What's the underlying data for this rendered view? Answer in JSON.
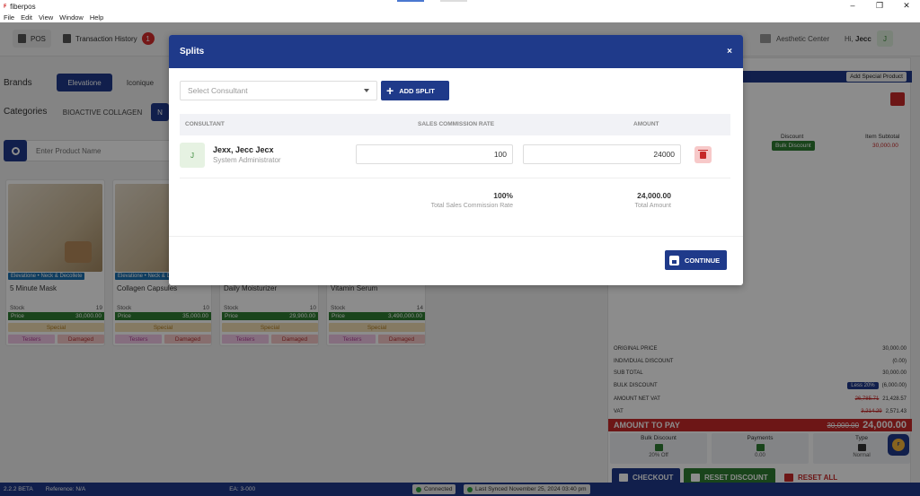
{
  "window": {
    "title": "fiberpos",
    "logo": "ꟳ",
    "controls": [
      "–",
      "❐",
      "✕"
    ]
  },
  "menu": [
    "File",
    "Edit",
    "View",
    "Window",
    "Help"
  ],
  "header": {
    "pos_label": "POS",
    "transactions_label": "Transaction History",
    "transactions_count": "1",
    "store_name": "Aesthetic Center",
    "greeting": "Hi,",
    "user_name": "Jecc",
    "user_initial": "J"
  },
  "left": {
    "brands_label": "Brands",
    "brands": [
      "Elevatione",
      "Iconique"
    ],
    "categories_label": "Categories",
    "categories": [
      "BIOACTIVE COLLAGEN",
      "N"
    ],
    "search_placeholder": "Enter Product Name",
    "stock_label": "Stock",
    "price_label": "Price",
    "special_label": "Special",
    "testers_label": "Testers",
    "damaged_label": "Damaged",
    "products": [
      {
        "tag": "Elevatione • Neck & Decollete",
        "name": "5 Minute Mask",
        "stock": "19",
        "price": "30,000.00"
      },
      {
        "tag": "Elevatione • Neck & D",
        "name": "Collagen Capsules",
        "stock": "10",
        "price": "35,000.00"
      },
      {
        "tag": "",
        "name": "Daily Moisturizer",
        "stock": "10",
        "price": "29,900.00"
      },
      {
        "tag": "",
        "name": "Vitamin Serum",
        "stock": "14",
        "price": "3,490,000.00"
      }
    ]
  },
  "cart": {
    "add_special": "Add Special Product",
    "discount_label": "Discount",
    "subtotal_label": "Item Subtotal",
    "bulk_discount_pill": "Bulk Discount",
    "subtotal_value": "30,000.00",
    "summary": [
      {
        "label": "ORIGINAL PRICE",
        "value": "30,000.00"
      },
      {
        "label": "INDIVIDUAL DISCOUNT",
        "value": "(0.00)"
      },
      {
        "label": "SUB TOTAL",
        "value": "30,000.00"
      }
    ],
    "bulk_discount_label": "BULK DISCOUNT",
    "bulk_less": "Less 20%",
    "bulk_value": "(6,000.00)",
    "net_vat_label": "AMOUNT NET VAT",
    "net_vat_old": "26,785.71",
    "net_vat_value": "21,428.57",
    "vat_label": "VAT",
    "vat_old": "3,214.29",
    "vat_value": "2,571.43",
    "amount_to_pay_label": "AMOUNT TO PAY",
    "amount_to_pay_old": "30,000.00",
    "amount_to_pay_value": "24,000.00",
    "info": [
      {
        "label": "Bulk Discount",
        "value": "20% Off"
      },
      {
        "label": "Payments",
        "value": "0.00"
      },
      {
        "label": "Type",
        "value": "Normal"
      }
    ],
    "checkout_label": "CHECKOUT",
    "reset_discount_label": "RESET DISCOUNT",
    "reset_all_label": "RESET ALL"
  },
  "footer": {
    "version": "2.2.2 BETA",
    "reference": "Reference: N/A",
    "ea": "EA: 3-000",
    "connected": "Connected",
    "last_synced": "Last Synced November 25, 2024 03:40 pm"
  },
  "modal": {
    "title": "Splits",
    "close": "×",
    "consultant_placeholder": "Select Consultant",
    "add_split_label": "ADD SPLIT",
    "col_consultant": "CONSULTANT",
    "col_rate": "SALES COMMISSION RATE",
    "col_amount": "AMOUNT",
    "row": {
      "initial": "J",
      "name": "Jexx, Jecc Jecx",
      "role": "System Administrator",
      "rate": "100",
      "amount": "24000"
    },
    "total_rate": "100%",
    "total_rate_label": "Total Sales Commission Rate",
    "total_amount": "24,000.00",
    "total_amount_label": "Total Amount",
    "continue_label": "CONTINUE"
  }
}
